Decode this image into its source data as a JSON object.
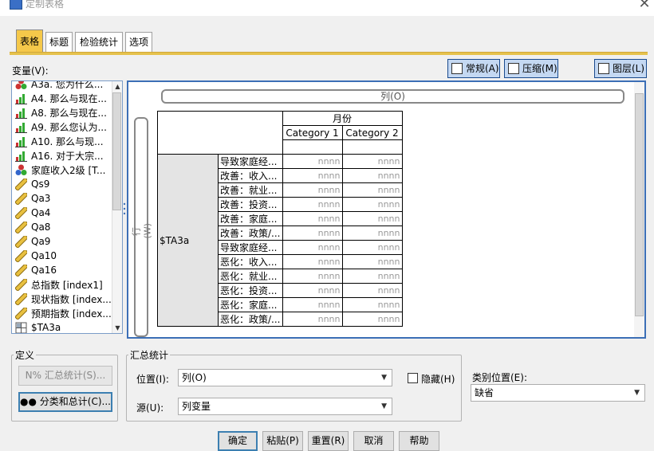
{
  "window": {
    "title": "定制表格",
    "close": "✕"
  },
  "tabs": [
    "表格",
    "标题",
    "检验统计",
    "选项"
  ],
  "variables": {
    "label": "变量(V):",
    "items": [
      {
        "label": "A3a. 您为什么...",
        "icon": "nominal"
      },
      {
        "label": "A4. 那么与现在...",
        "icon": "ordinal"
      },
      {
        "label": "A8. 那么与现在...",
        "icon": "ordinal"
      },
      {
        "label": "A9. 那么您认为...",
        "icon": "ordinal"
      },
      {
        "label": "A10. 那么与现...",
        "icon": "ordinal"
      },
      {
        "label": "A16. 对于大宗...",
        "icon": "ordinal"
      },
      {
        "label": "家庭收入2级 [T...",
        "icon": "nominal-blue"
      },
      {
        "label": "Qs9",
        "icon": "scale"
      },
      {
        "label": "Qa3",
        "icon": "scale"
      },
      {
        "label": "Qa4",
        "icon": "scale"
      },
      {
        "label": "Qa8",
        "icon": "scale"
      },
      {
        "label": "Qa9",
        "icon": "scale"
      },
      {
        "label": "Qa10",
        "icon": "scale"
      },
      {
        "label": "Qa16",
        "icon": "scale"
      },
      {
        "label": "总指数 [index1]",
        "icon": "scale"
      },
      {
        "label": "现状指数 [index...",
        "icon": "scale"
      },
      {
        "label": "预期指数 [index...",
        "icon": "scale"
      },
      {
        "label": "$TA3a",
        "icon": "multiset"
      }
    ]
  },
  "toolbar": {
    "normal": "常规(A)",
    "compact": "压缩(M)",
    "layers": "图层(L)"
  },
  "canvas": {
    "col_bar": "列(O)",
    "row_bar": "行(W)",
    "col_header": "月份",
    "categories": [
      "Category 1",
      "Category 2"
    ],
    "row_var": "$TA3a",
    "row_labels": [
      "导致家庭经...",
      "改善：收入...",
      "改善：就业...",
      "改善：投资...",
      "改善：家庭...",
      "改善：政策/...",
      "导致家庭经...",
      "恶化：收入...",
      "恶化：就业...",
      "恶化：投资...",
      "恶化：家庭...",
      "恶化：政策/..."
    ],
    "cell": "nnnn"
  },
  "define": {
    "legend": "定义",
    "summary_btn": "汇总统计(S)...",
    "category_btn": "分类和总计(C)..."
  },
  "summary": {
    "legend": "汇总统计",
    "position_label": "位置(I):",
    "position_value": "列(O)",
    "source_label": "源(U):",
    "source_value": "列变量",
    "hide_label": "隐藏(H)"
  },
  "catpos": {
    "label": "类别位置(E):",
    "value": "缺省"
  },
  "buttons": {
    "ok": "确定",
    "paste": "粘贴(P)",
    "reset": "重置(R)",
    "cancel": "取消",
    "help": "帮助"
  }
}
